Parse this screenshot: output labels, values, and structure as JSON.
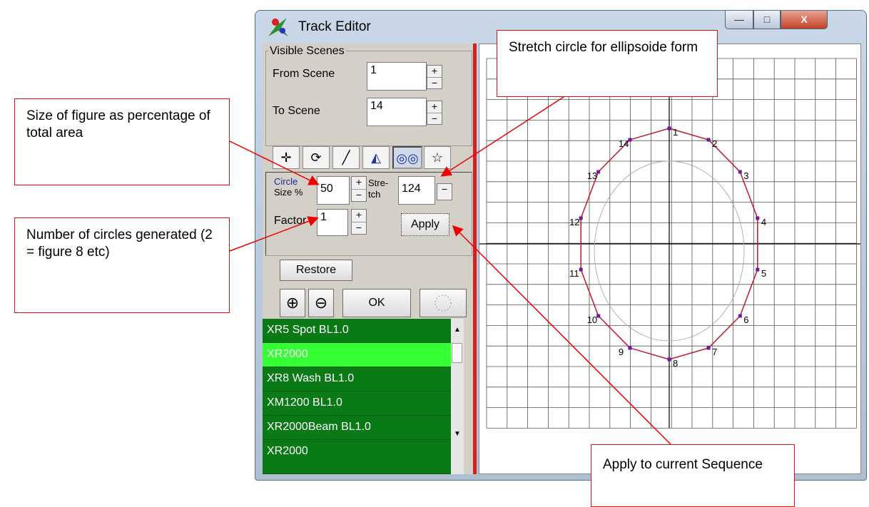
{
  "window": {
    "title": "Track Editor",
    "minimize_glyph": "—",
    "maximize_glyph": "□",
    "close_glyph": "X"
  },
  "visible_scenes": {
    "legend": "Visible Scenes",
    "from_label": "From Scene",
    "from_value": "1",
    "to_label": "To Scene",
    "to_value": "14"
  },
  "tools": [
    {
      "icon": "move-icon",
      "glyph": "✛"
    },
    {
      "icon": "rotate-icon",
      "glyph": "⟳"
    },
    {
      "icon": "line-icon",
      "glyph": "╱"
    },
    {
      "icon": "shape-icon",
      "glyph": "◭"
    },
    {
      "icon": "circles-icon",
      "glyph": "◎◎"
    },
    {
      "icon": "star-icon",
      "glyph": "☆"
    }
  ],
  "circle_params": {
    "size_label_1": "Circle",
    "size_label_2": "Size %",
    "size_value": "50",
    "stretch_label_1": "Stre-",
    "stretch_label_2": "tch",
    "stretch_value": "124",
    "factor_label": "Factor",
    "factor_value": "1",
    "apply_label": "Apply"
  },
  "buttons": {
    "restore_label": "Restore",
    "ok_label": "OK",
    "zoom_in_glyph": "⊕",
    "zoom_out_glyph": "⊖"
  },
  "fixtures": [
    "XR5 Spot BL1.0",
    "XR2000",
    "XR8 Wash BL1.0",
    "XM1200 BL1.0",
    "XR2000Beam BL1.0",
    "XR2000"
  ],
  "colors": {
    "list_green": "#0a7a16",
    "list_selected": "#33ff33",
    "track_red": "#c2182b",
    "point_purple": "#6a1a9a",
    "splitter_red": "#d62020"
  },
  "track": {
    "point_labels": [
      "1",
      "2",
      "3",
      "4",
      "5",
      "6",
      "7",
      "8",
      "9",
      "10",
      "11",
      "12",
      "13",
      "14"
    ]
  },
  "callouts": {
    "size": "Size of figure as percentage of total area",
    "circles": "Number of circles generated (2 = figure 8 etc)",
    "stretch": "Stretch circle for ellipsoide form",
    "apply": "Apply to current Sequence"
  }
}
